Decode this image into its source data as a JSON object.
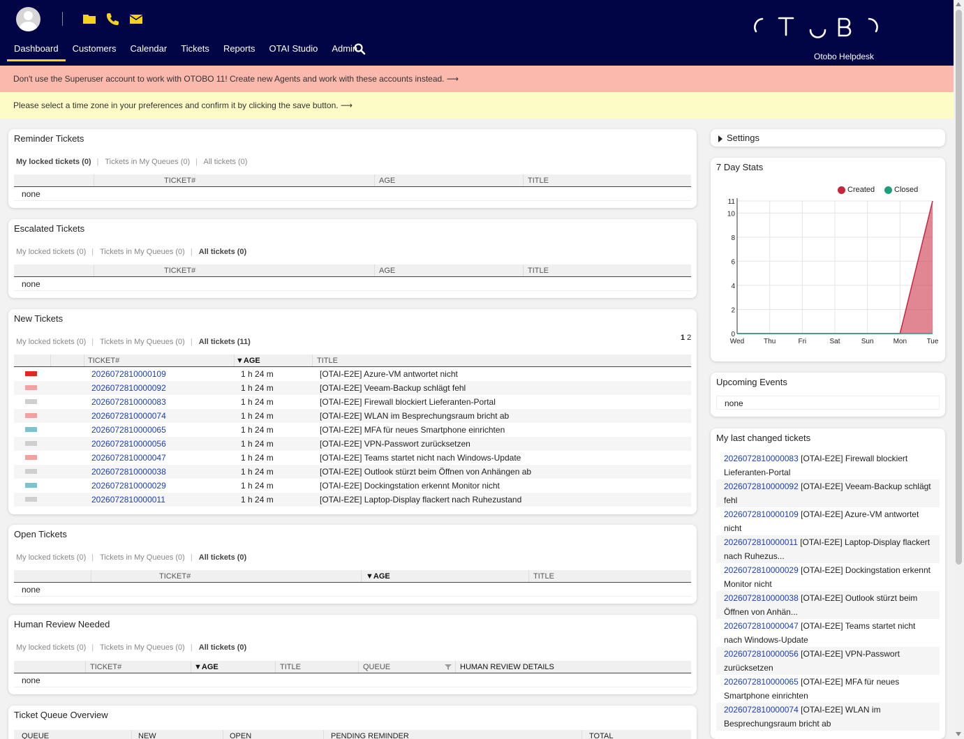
{
  "header": {
    "logo_text": "OTOBO",
    "logo_subtitle": "Otobo Helpdesk",
    "nav": [
      {
        "label": "Dashboard",
        "active": true
      },
      {
        "label": "Customers"
      },
      {
        "label": "Calendar"
      },
      {
        "label": "Tickets"
      },
      {
        "label": "Reports"
      },
      {
        "label": "OTAI Studio"
      },
      {
        "label": "Admin"
      }
    ],
    "icons": [
      "avatar",
      "folder-icon",
      "phone-icon",
      "envelope-icon",
      "search-icon"
    ]
  },
  "banners": {
    "superuser": "Don't use the Superuser account to work with OTOBO 11! Create new Agents and work with these accounts instead. ⟶",
    "timezone": "Please select a time zone in your preferences and confirm it by clicking the save button. ⟶"
  },
  "colors": {
    "header_bg": "#020545",
    "accent_yellow": "#f4d21f",
    "banner_red": "#fbb8ac",
    "banner_yellow": "#fdfbc6",
    "link": "#1a3fb0",
    "created": "#c8243d",
    "closed": "#1da07a"
  },
  "common": {
    "none": "none",
    "col_ticket": "TICKET#",
    "col_age": "AGE",
    "col_age_sorted": "▼AGE",
    "col_title": "TITLE",
    "col_queue": "QUEUE",
    "col_review": "HUMAN REVIEW DETAILS"
  },
  "reminder": {
    "title": "Reminder Tickets",
    "filters": [
      "My locked tickets (0)",
      "Tickets in My Queues (0)",
      "All tickets (0)"
    ]
  },
  "escalated": {
    "title": "Escalated Tickets",
    "filters": [
      "My locked tickets (0)",
      "Tickets in My Queues (0)",
      "All tickets (0)"
    ]
  },
  "new_tickets": {
    "title": "New Tickets",
    "filters": [
      "My locked tickets (0)",
      "Tickets in My Queues (0)",
      "All tickets (11)"
    ],
    "pages": [
      "1",
      "2"
    ],
    "rows": [
      {
        "prio": "#e8251a",
        "number": "2026072810000109",
        "age": "1 h 24 m",
        "title": "[OTAI-E2E] Azure-VM antwortet nicht"
      },
      {
        "prio": "#f5a0a0",
        "number": "2026072810000092",
        "age": "1 h 24 m",
        "title": "[OTAI-E2E] Veeam-Backup schlägt fehl"
      },
      {
        "prio": "#cfcfcf",
        "number": "2026072810000083",
        "age": "1 h 24 m",
        "title": "[OTAI-E2E] Firewall blockiert Lieferanten-Portal"
      },
      {
        "prio": "#f5a0a0",
        "number": "2026072810000074",
        "age": "1 h 24 m",
        "title": "[OTAI-E2E] WLAN im Besprechungsraum bricht ab"
      },
      {
        "prio": "#7cc4cc",
        "number": "2026072810000065",
        "age": "1 h 24 m",
        "title": "[OTAI-E2E] MFA für neues Smartphone einrichten"
      },
      {
        "prio": "#cfcfcf",
        "number": "2026072810000056",
        "age": "1 h 24 m",
        "title": "[OTAI-E2E] VPN-Passwort zurücksetzen"
      },
      {
        "prio": "#f5a0a0",
        "number": "2026072810000047",
        "age": "1 h 24 m",
        "title": "[OTAI-E2E] Teams startet nicht nach Windows-Update"
      },
      {
        "prio": "#cfcfcf",
        "number": "2026072810000038",
        "age": "1 h 24 m",
        "title": "[OTAI-E2E] Outlook stürzt beim Öffnen von Anhängen ab"
      },
      {
        "prio": "#7cc4cc",
        "number": "2026072810000029",
        "age": "1 h 24 m",
        "title": "[OTAI-E2E] Dockingstation erkennt Monitor nicht"
      },
      {
        "prio": "#cfcfcf",
        "number": "2026072810000011",
        "age": "1 h 24 m",
        "title": "[OTAI-E2E] Laptop-Display flackert nach Ruhezustand"
      }
    ]
  },
  "open": {
    "title": "Open Tickets",
    "filters": [
      "My locked tickets (0)",
      "Tickets in My Queues (0)",
      "All tickets (0)"
    ]
  },
  "human_review": {
    "title": "Human Review Needed",
    "filters": [
      "My locked tickets (0)",
      "Tickets in My Queues (0)",
      "All tickets (0)"
    ]
  },
  "queue_overview": {
    "title": "Ticket Queue Overview",
    "columns": [
      "QUEUE",
      "NEW",
      "OPEN",
      "PENDING REMINDER",
      "TOTAL"
    ]
  },
  "settings": {
    "label": "Settings"
  },
  "stats": {
    "title": "7 Day Stats"
  },
  "chart_data": {
    "type": "area",
    "title": "7 Day Stats",
    "categories": [
      "Wed",
      "Thu",
      "Fri",
      "Sat",
      "Sun",
      "Mon",
      "Tue"
    ],
    "series": [
      {
        "name": "Created",
        "values": [
          0,
          0,
          0,
          0,
          0,
          0,
          11
        ]
      },
      {
        "name": "Closed",
        "values": [
          0,
          0,
          0,
          0,
          0,
          0,
          0
        ]
      }
    ],
    "y_ticks": [
      "0",
      "2",
      "4",
      "6",
      "8",
      "10",
      "11"
    ],
    "ylim": [
      0,
      11
    ],
    "grid": true,
    "legend": "top-right"
  },
  "upcoming": {
    "title": "Upcoming Events"
  },
  "last_changed": {
    "title": "My last changed tickets",
    "rows": [
      {
        "number": "2026072810000083",
        "line1": " [OTAI-E2E] Firewall blockiert",
        "line2": "Lieferanten-Portal"
      },
      {
        "number": "2026072810000092",
        "line1": " [OTAI-E2E] Veeam-Backup schlägt",
        "line2": "fehl"
      },
      {
        "number": "2026072810000109",
        "line1": " [OTAI-E2E] Azure-VM antwortet",
        "line2": "nicht"
      },
      {
        "number": "2026072810000011",
        "line1": " [OTAI-E2E] Laptop-Display flackert",
        "line2": "nach Ruhezus..."
      },
      {
        "number": "2026072810000029",
        "line1": " [OTAI-E2E] Dockingstation erkennt",
        "line2": "Monitor nicht"
      },
      {
        "number": "2026072810000038",
        "line1": " [OTAI-E2E] Outlook stürzt beim",
        "line2": "Öffnen von Anhän..."
      },
      {
        "number": "2026072810000047",
        "line1": " [OTAI-E2E] Teams startet nicht",
        "line2": "nach Windows-Update"
      },
      {
        "number": "2026072810000056",
        "line1": " [OTAI-E2E] VPN-Passwort",
        "line2": "zurücksetzen"
      },
      {
        "number": "2026072810000065",
        "line1": " [OTAI-E2E] MFA für neues",
        "line2": "Smartphone einrichten"
      },
      {
        "number": "2026072810000074",
        "line1": " [OTAI-E2E] WLAN im",
        "line2": "Besprechungsraum bricht ab"
      }
    ]
  }
}
